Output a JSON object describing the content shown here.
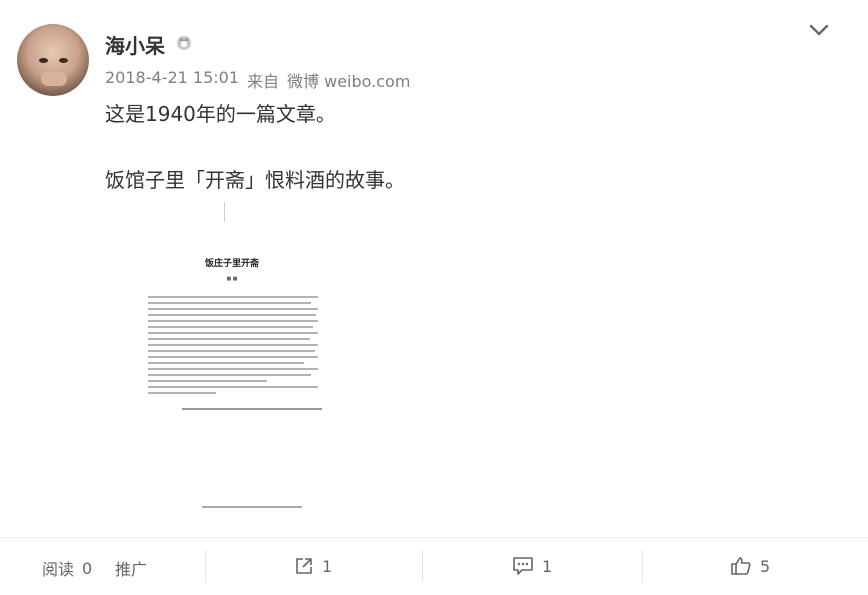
{
  "post": {
    "username": "海小呆",
    "timestamp": "2018-4-21 15:01",
    "source_prefix": "来自",
    "source": "微博 weibo.com",
    "text_line1": "这是1940年的一篇文章。",
    "text_line2": "饭馆子里「开斋」恨料酒的故事。"
  },
  "attachment": {
    "title": "饭庄子里开斋"
  },
  "actions": {
    "read_label": "阅读",
    "read_count": "0",
    "promote_label": "推广",
    "share_count": "1",
    "comment_count": "1",
    "like_count": "5"
  },
  "icons": [
    "vip-badge-icon",
    "chevron-down-icon",
    "share-icon",
    "comment-icon",
    "like-icon"
  ]
}
